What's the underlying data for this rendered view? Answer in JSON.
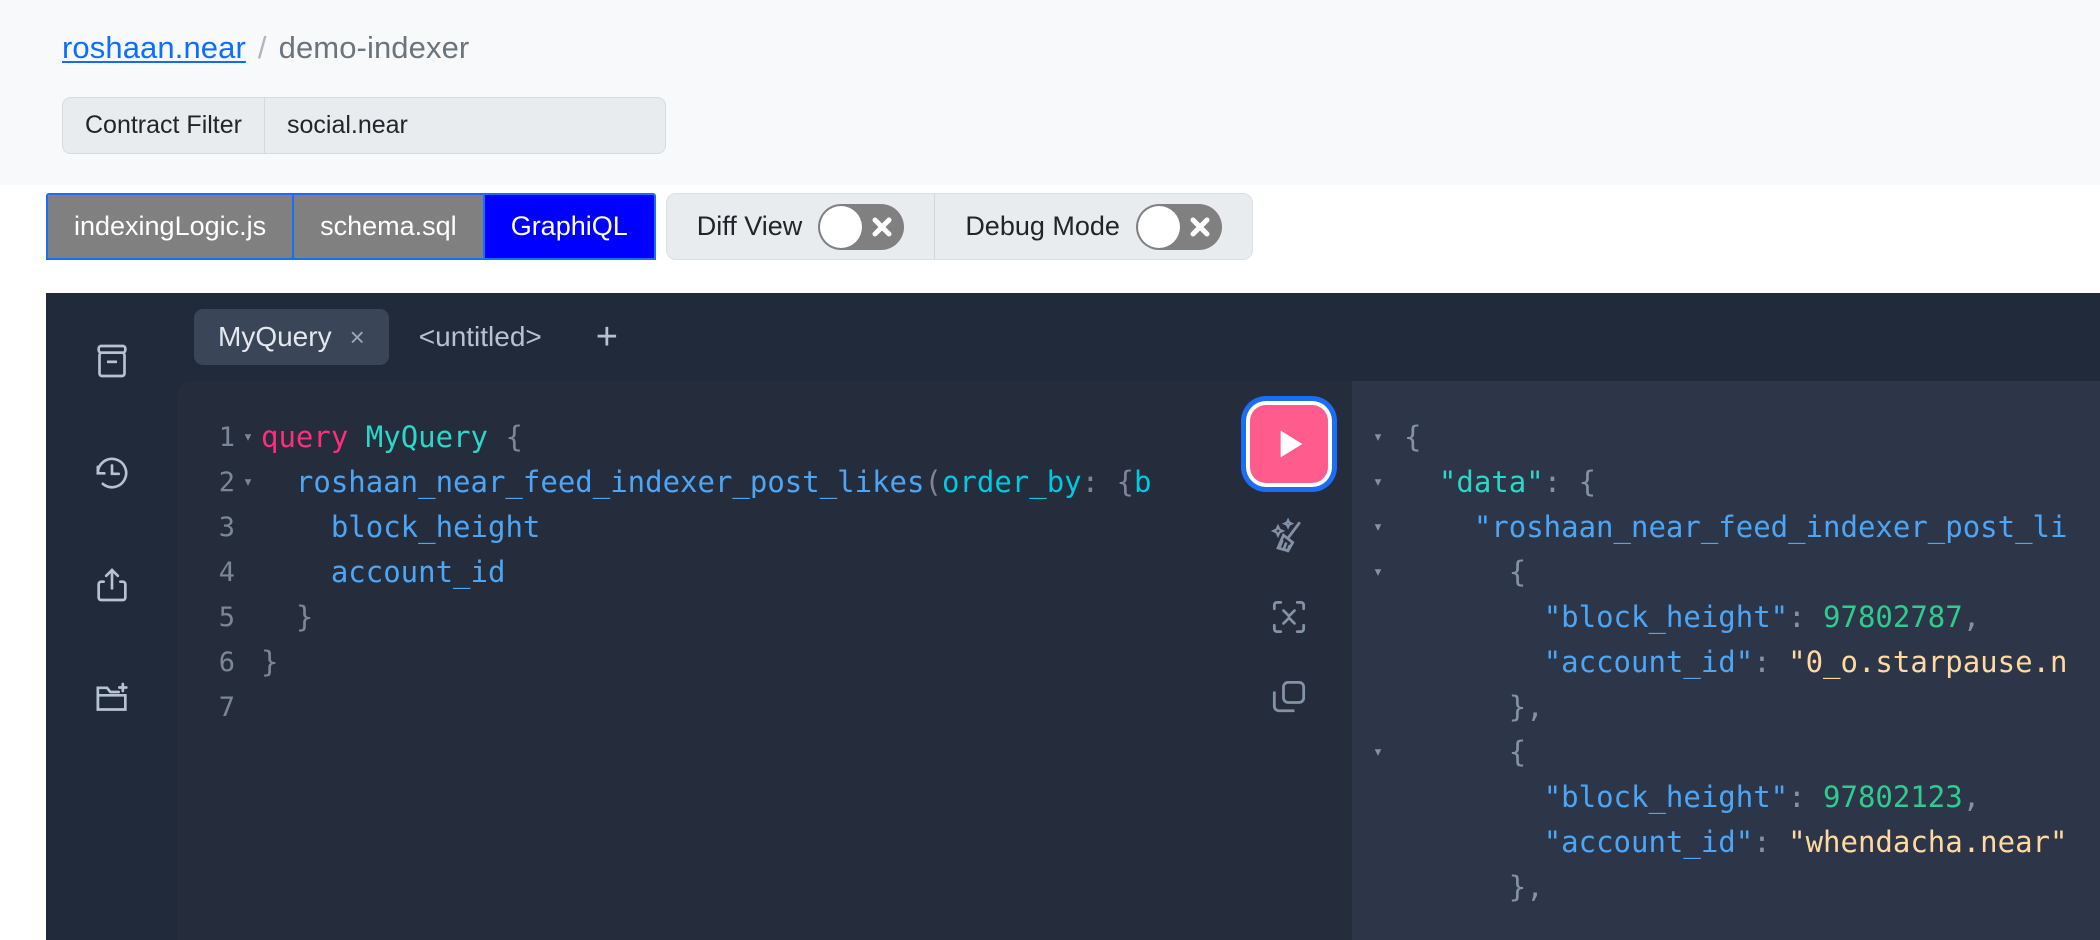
{
  "breadcrumb": {
    "account": "roshaan.near",
    "separator": "/",
    "current": "demo-indexer"
  },
  "contract_filter": {
    "label": "Contract Filter",
    "value": "social.near",
    "placeholder": "social.near"
  },
  "nav_tabs": [
    {
      "label": "indexingLogic.js",
      "active": false
    },
    {
      "label": "schema.sql",
      "active": false
    },
    {
      "label": "GraphiQL",
      "active": true
    }
  ],
  "toggles": [
    {
      "label": "Diff View",
      "state": "off",
      "icon": "close-x-icon"
    },
    {
      "label": "Debug Mode",
      "state": "off",
      "icon": "close-x-icon"
    }
  ],
  "graphiql": {
    "sidebar_icons": [
      "docs-book-icon",
      "history-clock-icon",
      "share-upload-icon",
      "new-folder-icon"
    ],
    "query_tabs": [
      {
        "label": "MyQuery",
        "active": true,
        "close": "×"
      },
      {
        "label": "<untitled>",
        "active": false,
        "close": ""
      }
    ],
    "add_tab_label": "+",
    "exec_icons": [
      "play-execute-icon",
      "prettify-broom-icon",
      "merge-fragments-icon",
      "copy-query-icon"
    ],
    "editor": {
      "lines": [
        {
          "num": "1",
          "fold": "▾",
          "tokens": [
            {
              "t": "query",
              "c": "kw"
            },
            {
              "t": " ",
              "c": "code-text"
            },
            {
              "t": "MyQuery",
              "c": "opname"
            },
            {
              "t": " {",
              "c": "punct"
            }
          ]
        },
        {
          "num": "2",
          "fold": "▾",
          "tokens": [
            {
              "t": "  ",
              "c": "code-text"
            },
            {
              "t": "roshaan_near_feed_indexer_post_likes",
              "c": "field"
            },
            {
              "t": "(",
              "c": "punct"
            },
            {
              "t": "order_by",
              "c": "arg"
            },
            {
              "t": ": ",
              "c": "punct"
            },
            {
              "t": "{",
              "c": "punct"
            },
            {
              "t": "b",
              "c": "arg"
            }
          ]
        },
        {
          "num": "3",
          "fold": "",
          "tokens": [
            {
              "t": "    ",
              "c": "code-text"
            },
            {
              "t": "block_height",
              "c": "field"
            }
          ]
        },
        {
          "num": "4",
          "fold": "",
          "tokens": [
            {
              "t": "    ",
              "c": "code-text"
            },
            {
              "t": "account_id",
              "c": "field"
            }
          ]
        },
        {
          "num": "5",
          "fold": "",
          "tokens": [
            {
              "t": "  }",
              "c": "punct"
            }
          ]
        },
        {
          "num": "6",
          "fold": "",
          "tokens": [
            {
              "t": "}",
              "c": "punct"
            }
          ]
        },
        {
          "num": "7",
          "fold": "",
          "tokens": []
        }
      ]
    },
    "response": {
      "lines": [
        {
          "fold": "▾",
          "tokens": [
            {
              "t": "{",
              "c": "jpunct"
            }
          ]
        },
        {
          "fold": "▾",
          "tokens": [
            {
              "t": "  ",
              "c": "jtext"
            },
            {
              "t": "\"data\"",
              "c": "jkey-data"
            },
            {
              "t": ": {",
              "c": "jpunct"
            }
          ]
        },
        {
          "fold": "▾",
          "tokens": [
            {
              "t": "    ",
              "c": "jtext"
            },
            {
              "t": "\"roshaan_near_feed_indexer_post_li",
              "c": "jkey"
            }
          ]
        },
        {
          "fold": "▾",
          "tokens": [
            {
              "t": "      {",
              "c": "jpunct"
            }
          ]
        },
        {
          "fold": "",
          "tokens": [
            {
              "t": "        ",
              "c": "jtext"
            },
            {
              "t": "\"block_height\"",
              "c": "jkey"
            },
            {
              "t": ": ",
              "c": "jpunct"
            },
            {
              "t": "97802787",
              "c": "jnum"
            },
            {
              "t": ",",
              "c": "jpunct"
            }
          ]
        },
        {
          "fold": "",
          "tokens": [
            {
              "t": "        ",
              "c": "jtext"
            },
            {
              "t": "\"account_id\"",
              "c": "jkey"
            },
            {
              "t": ": ",
              "c": "jpunct"
            },
            {
              "t": "\"0_o.starpause.n",
              "c": "jstr"
            }
          ]
        },
        {
          "fold": "",
          "tokens": [
            {
              "t": "      },",
              "c": "jpunct"
            }
          ]
        },
        {
          "fold": "▾",
          "tokens": [
            {
              "t": "      {",
              "c": "jpunct"
            }
          ]
        },
        {
          "fold": "",
          "tokens": [
            {
              "t": "        ",
              "c": "jtext"
            },
            {
              "t": "\"block_height\"",
              "c": "jkey"
            },
            {
              "t": ": ",
              "c": "jpunct"
            },
            {
              "t": "97802123",
              "c": "jnum"
            },
            {
              "t": ",",
              "c": "jpunct"
            }
          ]
        },
        {
          "fold": "",
          "tokens": [
            {
              "t": "        ",
              "c": "jtext"
            },
            {
              "t": "\"account_id\"",
              "c": "jkey"
            },
            {
              "t": ": ",
              "c": "jpunct"
            },
            {
              "t": "\"whendacha.near\"",
              "c": "jstr"
            }
          ]
        },
        {
          "fold": "",
          "tokens": [
            {
              "t": "      },",
              "c": "jpunct"
            }
          ]
        }
      ]
    }
  },
  "colors": {
    "accent_blue": "#0000ff",
    "link_blue": "#0d6efd",
    "focus_blue": "#1b6ef3",
    "play_pink": "#ff5c8d",
    "editor_bg": "#252d3d",
    "response_bg": "#2d3648",
    "shell_bg": "#212a3b",
    "tab_gray": "#808080",
    "band_bg": "#f8f9fa"
  }
}
